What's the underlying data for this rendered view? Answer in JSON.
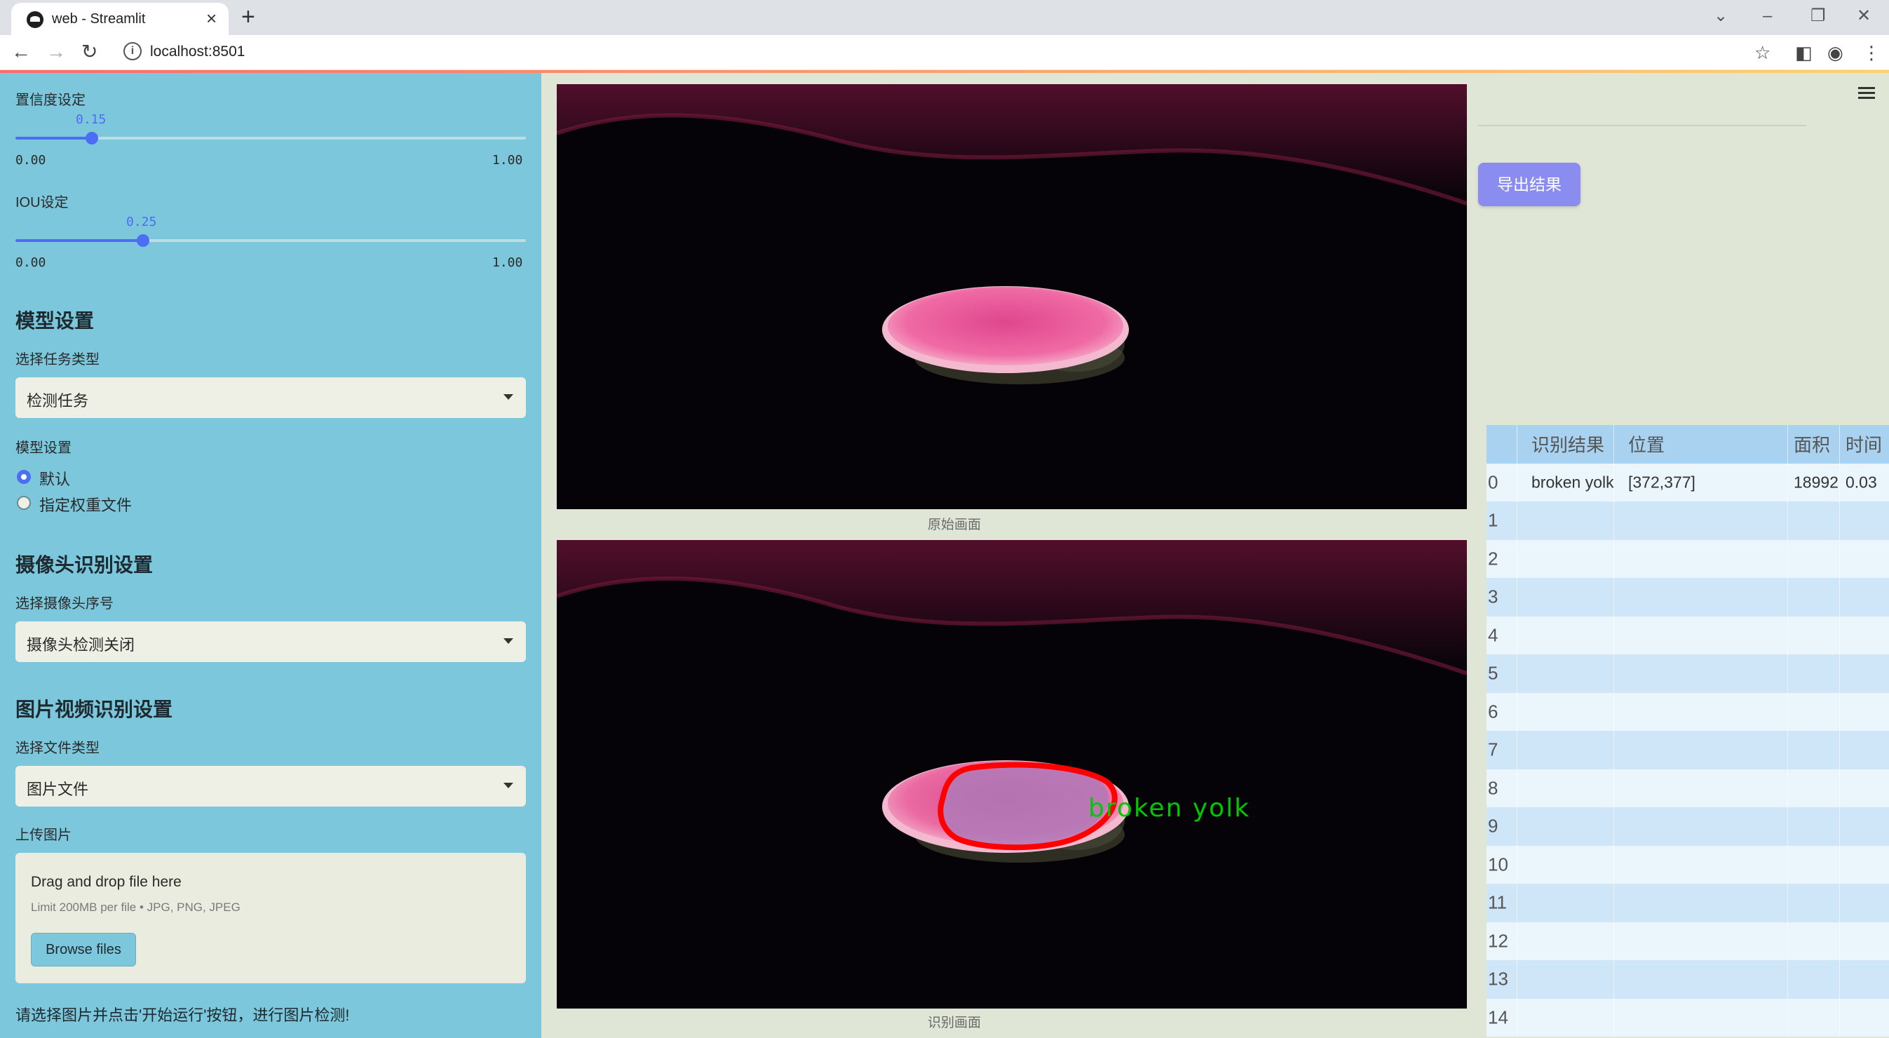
{
  "browser": {
    "tab_title": "web - Streamlit",
    "url": "localhost:8501"
  },
  "sidebar": {
    "confidence": {
      "label": "置信度设定",
      "value": "0.15",
      "min": "0.00",
      "max": "1.00",
      "fraction": 0.15
    },
    "iou": {
      "label": "IOU设定",
      "value": "0.25",
      "min": "0.00",
      "max": "1.00",
      "fraction": 0.25
    },
    "model_heading": "模型设置",
    "task_type_label": "选择任务类型",
    "task_type_value": "检测任务",
    "model_setting_label": "模型设置",
    "model_options": [
      {
        "label": "默认",
        "selected": true
      },
      {
        "label": "指定权重文件",
        "selected": false
      }
    ],
    "camera_heading": "摄像头识别设置",
    "camera_label": "选择摄像头序号",
    "camera_value": "摄像头检测关闭",
    "media_heading": "图片视频识别设置",
    "file_type_label": "选择文件类型",
    "file_type_value": "图片文件",
    "upload_label": "上传图片",
    "upload_main": "Drag and drop file here",
    "upload_limit": "Limit 200MB per file • JPG, PNG, JPEG",
    "browse_label": "Browse files",
    "hint": "请选择图片并点击'开始运行'按钮，进行图片检测!"
  },
  "main": {
    "original_caption": "原始画面",
    "result_caption": "识别画面",
    "detection_label": "broken yolk"
  },
  "right_panel": {
    "export_label": "导出结果",
    "table": {
      "headers": [
        "",
        "识别结果",
        "位置",
        "面积",
        "时间"
      ],
      "rows": [
        [
          "0",
          "broken yolk",
          "[372,377]",
          "18992",
          "0.03"
        ],
        [
          "1",
          "",
          "",
          "",
          ""
        ],
        [
          "2",
          "",
          "",
          "",
          ""
        ],
        [
          "3",
          "",
          "",
          "",
          ""
        ],
        [
          "4",
          "",
          "",
          "",
          ""
        ],
        [
          "5",
          "",
          "",
          "",
          ""
        ],
        [
          "6",
          "",
          "",
          "",
          ""
        ],
        [
          "7",
          "",
          "",
          "",
          ""
        ],
        [
          "8",
          "",
          "",
          "",
          ""
        ],
        [
          "9",
          "",
          "",
          "",
          ""
        ],
        [
          "10",
          "",
          "",
          "",
          ""
        ],
        [
          "11",
          "",
          "",
          "",
          ""
        ],
        [
          "12",
          "",
          "",
          "",
          ""
        ],
        [
          "13",
          "",
          "",
          "",
          ""
        ],
        [
          "14",
          "",
          "",
          "",
          ""
        ]
      ]
    }
  },
  "colors": {
    "sidebar_bg": "#7dc7dc",
    "accent": "#4c6ef5",
    "export_button": "#8b8cf0",
    "detection_outline": "#ff0000",
    "detection_text": "#00c800"
  }
}
